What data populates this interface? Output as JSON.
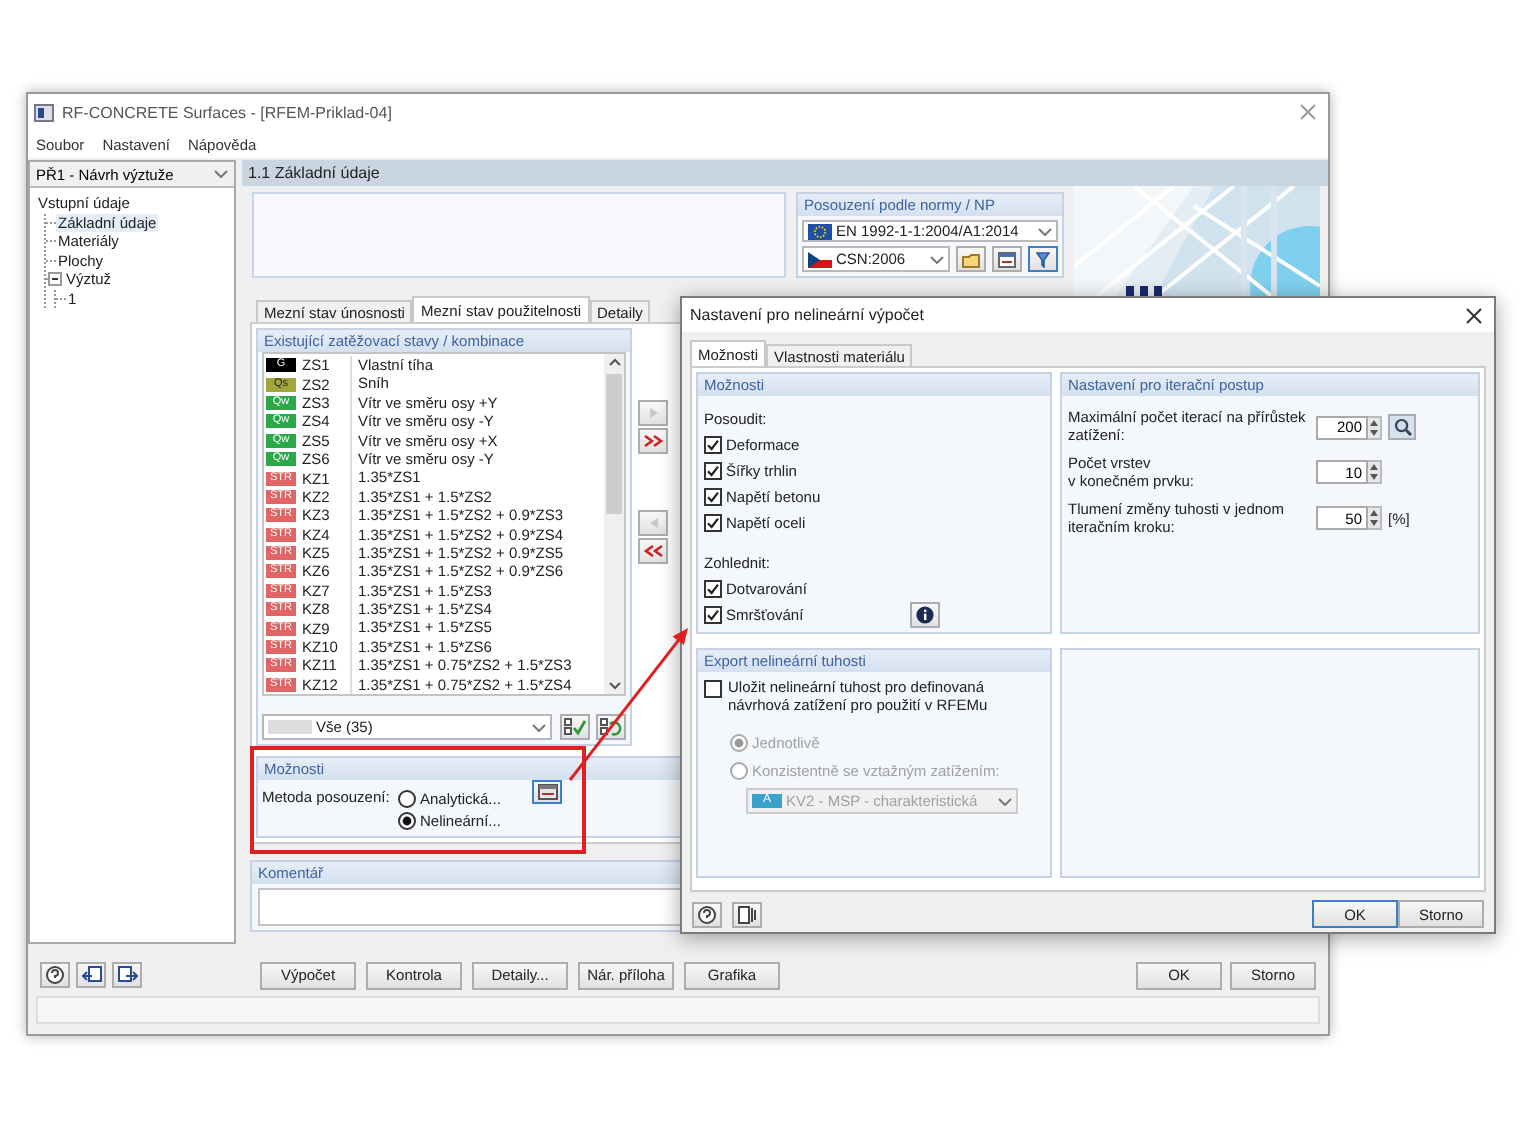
{
  "main_window": {
    "title": "RF-CONCRETE Surfaces - [RFEM-Priklad-04]",
    "menu": [
      "Soubor",
      "Nastavení",
      "Nápověda"
    ],
    "case_selector": "PŘ1 - Návrh výztuže",
    "tree": [
      {
        "label": "Vstupní údaje",
        "selected": false,
        "children": [
          {
            "label": "Základní údaje",
            "selected": true
          },
          {
            "label": "Materiály",
            "selected": false
          },
          {
            "label": "Plochy",
            "selected": false
          },
          {
            "label": "Výztuž",
            "selected": false,
            "expanded": true,
            "children": [
              {
                "label": "1",
                "selected": false
              }
            ]
          }
        ]
      }
    ],
    "page_header": "1.1 Základní údaje",
    "design_code": {
      "title": "Posouzení podle normy / NP",
      "standard": "EN 1992-1-1:2004/A1:2014",
      "national_annex": "CSN:2006"
    },
    "tabs": [
      {
        "label": "Mezní stav únosnosti",
        "selected": false
      },
      {
        "label": "Mezní stav použitelnosti",
        "selected": true
      },
      {
        "label": "Detaily",
        "selected": false
      }
    ],
    "load_cases": {
      "title": "Existující zatěžovací stavy / kombinace",
      "rows": [
        {
          "tag": "G",
          "color": "#000000",
          "id": "ZS1",
          "description": "Vlastní tíha"
        },
        {
          "tag": "Qs",
          "color": "#a3a63c",
          "id": "ZS2",
          "description": "Sníh"
        },
        {
          "tag": "Qw",
          "color": "#2aa84a",
          "id": "ZS3",
          "description": "Vítr ve směru osy +Y"
        },
        {
          "tag": "Qw",
          "color": "#2aa84a",
          "id": "ZS4",
          "description": "Vítr ve směru osy -Y"
        },
        {
          "tag": "Qw",
          "color": "#2aa84a",
          "id": "ZS5",
          "description": "Vítr ve směru osy +X"
        },
        {
          "tag": "Qw",
          "color": "#2aa84a",
          "id": "ZS6",
          "description": "Vítr ve směru osy -Y"
        },
        {
          "tag": "STR",
          "color": "#e06666",
          "id": "KZ1",
          "description": "1.35*ZS1"
        },
        {
          "tag": "STR",
          "color": "#e06666",
          "id": "KZ2",
          "description": "1.35*ZS1 + 1.5*ZS2"
        },
        {
          "tag": "STR",
          "color": "#e06666",
          "id": "KZ3",
          "description": "1.35*ZS1 + 1.5*ZS2 + 0.9*ZS3"
        },
        {
          "tag": "STR",
          "color": "#e06666",
          "id": "KZ4",
          "description": "1.35*ZS1 + 1.5*ZS2 + 0.9*ZS4"
        },
        {
          "tag": "STR",
          "color": "#e06666",
          "id": "KZ5",
          "description": "1.35*ZS1 + 1.5*ZS2 + 0.9*ZS5"
        },
        {
          "tag": "STR",
          "color": "#e06666",
          "id": "KZ6",
          "description": "1.35*ZS1 + 1.5*ZS2 + 0.9*ZS6"
        },
        {
          "tag": "STR",
          "color": "#e06666",
          "id": "KZ7",
          "description": "1.35*ZS1 + 1.5*ZS3"
        },
        {
          "tag": "STR",
          "color": "#e06666",
          "id": "KZ8",
          "description": "1.35*ZS1 + 1.5*ZS4"
        },
        {
          "tag": "STR",
          "color": "#e06666",
          "id": "KZ9",
          "description": "1.35*ZS1 + 1.5*ZS5"
        },
        {
          "tag": "STR",
          "color": "#e06666",
          "id": "KZ10",
          "description": "1.35*ZS1 + 1.5*ZS6"
        },
        {
          "tag": "STR",
          "color": "#e06666",
          "id": "KZ11",
          "description": "1.35*ZS1 + 0.75*ZS2 + 1.5*ZS3"
        },
        {
          "tag": "STR",
          "color": "#e06666",
          "id": "KZ12",
          "description": "1.35*ZS1 + 0.75*ZS2 + 1.5*ZS4"
        }
      ],
      "filter": "Vše (35)"
    },
    "options": {
      "title": "Možnosti",
      "label": "Metoda posouzení:",
      "methods": [
        {
          "label": "Analytická...",
          "selected": false
        },
        {
          "label": "Nelineární...",
          "selected": true
        }
      ]
    },
    "comment": {
      "title": "Komentář"
    },
    "actions": [
      "Výpočet",
      "Kontrola",
      "Detaily...",
      "Nár. příloha",
      "Grafika"
    ],
    "buttons": [
      "OK",
      "Storno"
    ]
  },
  "dialog": {
    "title": "Nastavení pro nelineární výpočet",
    "tabs": [
      {
        "label": "Možnosti",
        "selected": true
      },
      {
        "label": "Vlastnosti materiálu",
        "selected": false
      }
    ],
    "options_group": {
      "title": "Možnosti",
      "design_heading": "Posoudit:",
      "design_checks": [
        {
          "label": "Deformace",
          "checked": true
        },
        {
          "label": "Šířky trhlin",
          "checked": true
        },
        {
          "label": "Napětí betonu",
          "checked": true
        },
        {
          "label": "Napětí oceli",
          "checked": true
        }
      ],
      "consider_heading": "Zohlednit:",
      "consider_checks": [
        {
          "label": "Dotvarování",
          "checked": true
        },
        {
          "label": "Smršťování",
          "checked": true
        }
      ]
    },
    "iteration_group": {
      "title": "Nastavení pro iterační postup",
      "settings": [
        {
          "lines": [
            "Maximální počet iterací na přírůstek",
            "zatížení:"
          ],
          "value": "200",
          "kind": "lookup"
        },
        {
          "lines": [
            "Počet vrstev",
            "v konečném prvku:"
          ],
          "value": "10",
          "kind": "plain"
        },
        {
          "lines": [
            "Tlumení změny tuhosti v jednom",
            "iteračním kroku:"
          ],
          "value": "50",
          "kind": "unit",
          "unit": "[%]"
        }
      ]
    },
    "export_group": {
      "title": "Export nelineární tuhosti",
      "save_check": {
        "label": "Uložit nelineární tuhost pro definovaná návrhová zatížení pro použití v RFEMu",
        "checked": false
      },
      "disabled": true,
      "modes": [
        {
          "label": "Jednotlivě",
          "selected": true
        },
        {
          "label": "Konzistentně se vztažným zatížením:",
          "selected": false
        }
      ],
      "combination": {
        "tag": "A",
        "color": "#3aa3cc",
        "label": "KV2 - MSP - charakteristická"
      }
    },
    "buttons": [
      "OK",
      "Storno"
    ]
  }
}
